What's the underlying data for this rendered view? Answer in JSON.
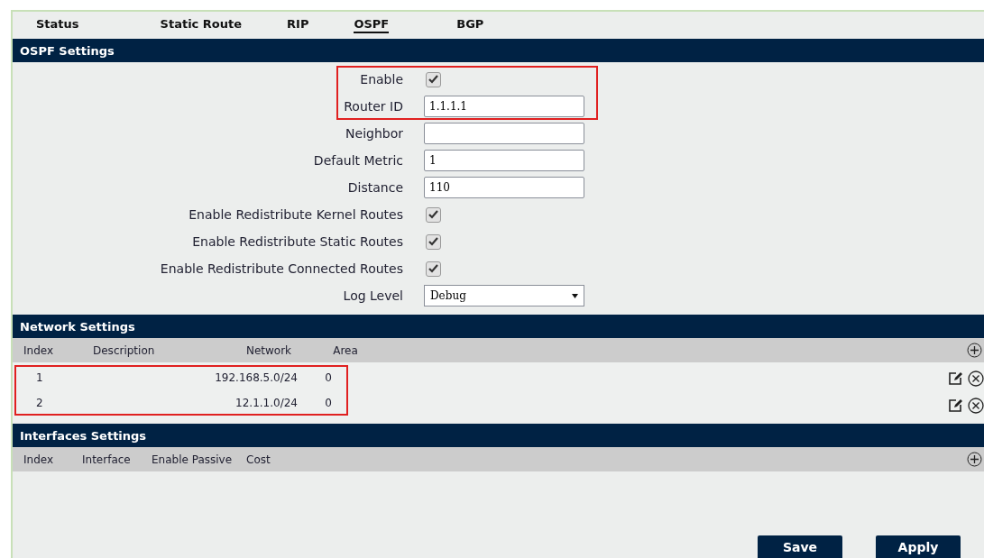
{
  "tabs": [
    {
      "label": "Status",
      "selected": false
    },
    {
      "label": "Static Route",
      "selected": false
    },
    {
      "label": "RIP",
      "selected": false
    },
    {
      "label": "OSPF",
      "selected": true
    },
    {
      "label": "BGP",
      "selected": false
    }
  ],
  "ospf_settings": {
    "title": "OSPF Settings",
    "fields": [
      {
        "label": "Enable",
        "kind": "checkbox",
        "checked": true,
        "highlighted": true
      },
      {
        "label": "Router ID",
        "kind": "text",
        "value": "1.1.1.1",
        "highlighted": true
      },
      {
        "label": "Neighbor",
        "kind": "text",
        "highlighted": false
      },
      {
        "label": "Default Metric",
        "kind": "text",
        "value": "1",
        "highlighted": false
      },
      {
        "label": "Distance",
        "kind": "text",
        "value": "110",
        "highlighted": false
      },
      {
        "label": "Enable Redistribute Kernel Routes",
        "kind": "checkbox",
        "checked": true,
        "highlighted": false
      },
      {
        "label": "Enable Redistribute Static Routes",
        "kind": "checkbox",
        "checked": true,
        "highlighted": false
      },
      {
        "label": "Enable Redistribute Connected Routes",
        "kind": "checkbox",
        "checked": true,
        "highlighted": false
      },
      {
        "label": "Log Level",
        "kind": "select",
        "value": "Debug",
        "highlighted": false
      }
    ]
  },
  "network_settings": {
    "title": "Network Settings",
    "columns": [
      "Index",
      "Description",
      "Network",
      "Area"
    ],
    "rows": [
      {
        "index": "1",
        "network": "192.168.5.0/24",
        "area": "0",
        "highlighted": true
      },
      {
        "index": "2",
        "network": "12.1.1.0/24",
        "area": "0",
        "highlighted": true
      }
    ]
  },
  "interfaces_settings": {
    "title": "Interfaces Settings",
    "columns": [
      "Index",
      "Interface",
      "Enable Passive",
      "Cost"
    ]
  },
  "buttons": [
    "Save",
    "Apply"
  ]
}
